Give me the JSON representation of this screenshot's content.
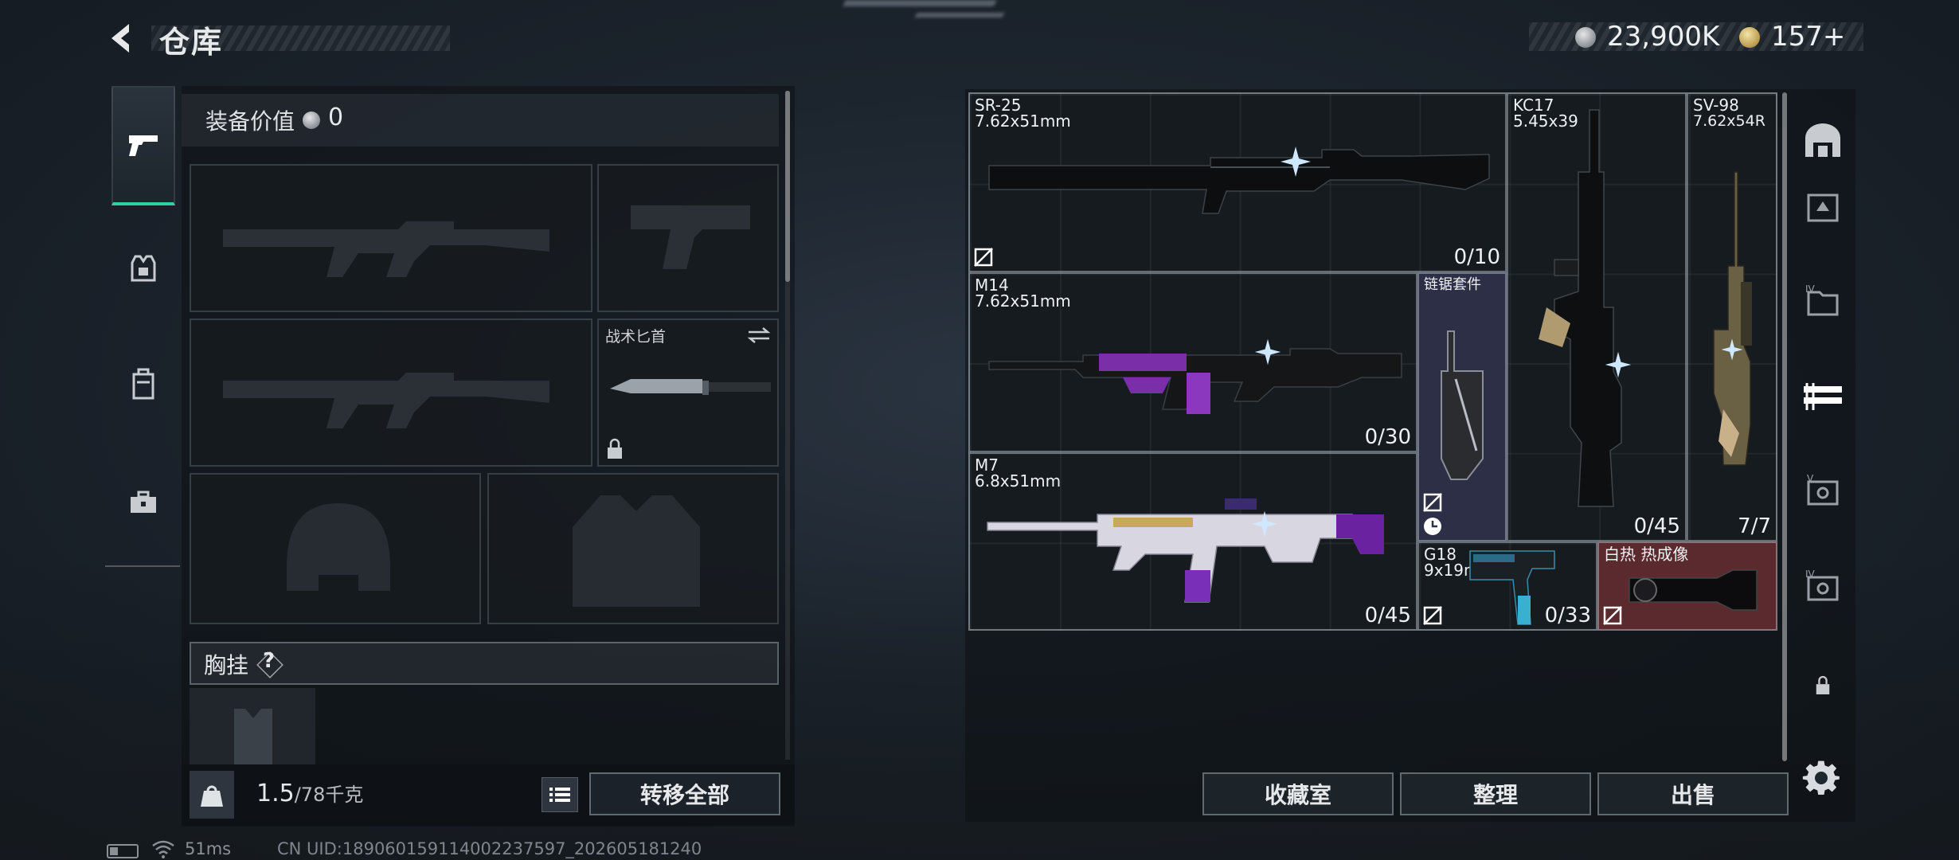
{
  "header": {
    "title": "仓库",
    "currency_silver": "23,900K",
    "currency_gold": "157+"
  },
  "loadout": {
    "value_label": "装备价值",
    "value": "0",
    "knife_label": "战术匕首",
    "rig_label": "胸挂",
    "help": "?",
    "weight": "1.5",
    "weight_max": "/78千克",
    "transfer_all": "转移全部"
  },
  "storage": {
    "items": [
      {
        "name": "SR-25",
        "caliber": "7.62x51mm",
        "ammo": "0/10"
      },
      {
        "name": "M14",
        "caliber": "7.62x51mm",
        "ammo": "0/30"
      },
      {
        "name": "M7",
        "caliber": "6.8x51mm",
        "ammo": "0/45"
      },
      {
        "name": "链锯套件",
        "caliber": "",
        "ammo": ""
      },
      {
        "name": "KC17",
        "caliber": "5.45x39",
        "ammo": "0/45"
      },
      {
        "name": "SV-98",
        "caliber": "7.62x54R",
        "ammo": "7/7"
      },
      {
        "name": "G18",
        "caliber": "9x19mm",
        "ammo": "0/33"
      },
      {
        "name": "白热 热成像",
        "caliber": "",
        "ammo": ""
      }
    ]
  },
  "actions": {
    "collection": "收藏室",
    "organize": "整理",
    "sell": "出售"
  },
  "status": {
    "ping": "51ms",
    "uid": "CN UID:18906015911400223759​7_202605181240"
  },
  "colors": {
    "accent_teal": "#2ed1a2",
    "thermal_bg": "#5a2a2e",
    "kit_bg": "#2c2f45"
  }
}
